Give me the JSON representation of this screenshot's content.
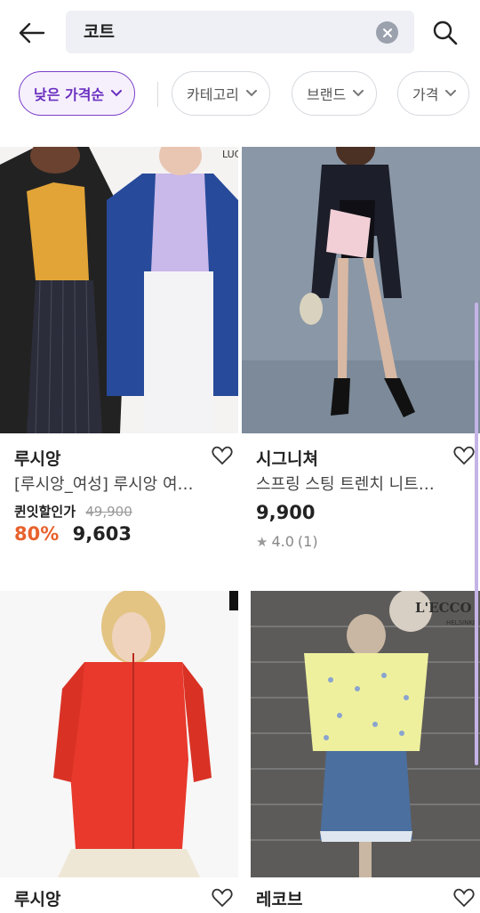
{
  "search": {
    "query": "코트"
  },
  "filters": [
    {
      "label": "낮은 가격순"
    },
    {
      "label": "카테고리"
    },
    {
      "label": "브랜드"
    },
    {
      "label": "가격"
    }
  ],
  "products": [
    {
      "brand": "루시앙",
      "title": "[루시앙_여성] 루시앙 여…",
      "deal_label": "퀸잇할인가",
      "original_price": "49,900",
      "discount": "80%",
      "price": "9,603",
      "image_corner_text": "LUC"
    },
    {
      "brand": "시그니쳐",
      "title": "스프링 스팅 트렌치 니트…",
      "price": "9,900",
      "rating": "4.0",
      "review_count": "(1)"
    },
    {
      "brand": "루시앙"
    },
    {
      "brand": "레코브",
      "image_sign": "L'ECCO",
      "image_sign_sub": "HELSINKI"
    }
  ],
  "colors": {
    "accent": "#6a2fbf",
    "discount": "#e8612c"
  }
}
